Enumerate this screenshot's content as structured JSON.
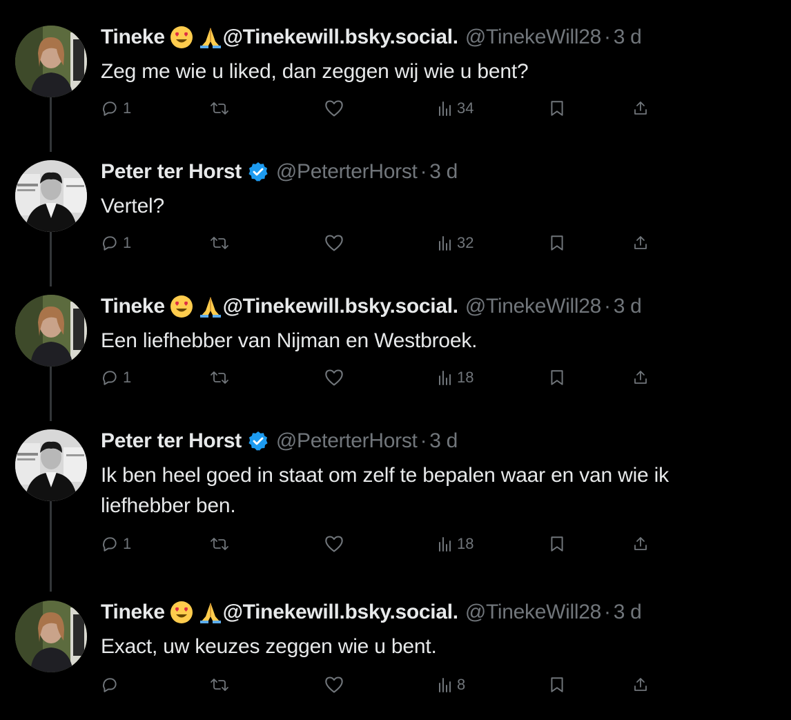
{
  "icons": {
    "reply": "reply-icon",
    "retweet": "retweet-icon",
    "like": "heart-icon",
    "views": "views-icon",
    "bookmark": "bookmark-icon",
    "share": "share-icon",
    "verified": "verified-badge-icon"
  },
  "colors": {
    "background": "#000000",
    "text": "#e7e9ea",
    "secondary": "#71767b",
    "verified": "#1d9bf0"
  },
  "tweets": [
    {
      "name": "Tineke",
      "suffix": "@Tinekewill.bsky.social.",
      "emojis": [
        "heart-eyes-emoji",
        "folded-hands-emoji"
      ],
      "verified": false,
      "handle": "@TinekeWill28",
      "dot": "·",
      "time": "3 d",
      "text": "Zeg me wie u liked, dan zeggen wij wie u bent?",
      "replies": "1",
      "retweets": "",
      "likes": "",
      "views": "34"
    },
    {
      "name": "Peter ter Horst",
      "suffix": "",
      "emojis": [],
      "verified": true,
      "handle": "@PeterterHorst",
      "dot": "·",
      "time": "3 d",
      "text": "Vertel?",
      "replies": "1",
      "retweets": "",
      "likes": "",
      "views": "32"
    },
    {
      "name": "Tineke",
      "suffix": "@Tinekewill.bsky.social.",
      "emojis": [
        "heart-eyes-emoji",
        "folded-hands-emoji"
      ],
      "verified": false,
      "handle": "@TinekeWill28",
      "dot": "·",
      "time": "3 d",
      "text": "Een liefhebber van Nijman en Westbroek.",
      "replies": "1",
      "retweets": "",
      "likes": "",
      "views": "18"
    },
    {
      "name": "Peter ter Horst",
      "suffix": "",
      "emojis": [],
      "verified": true,
      "handle": "@PeterterHorst",
      "dot": "·",
      "time": "3 d",
      "text": "Ik ben heel goed in staat om zelf te bepalen waar en van wie ik liefhebber ben.",
      "replies": "1",
      "retweets": "",
      "likes": "",
      "views": "18"
    },
    {
      "name": "Tineke",
      "suffix": "@Tinekewill.bsky.social.",
      "emojis": [
        "heart-eyes-emoji",
        "folded-hands-emoji"
      ],
      "verified": false,
      "handle": "@TinekeWill28",
      "dot": "·",
      "time": "3 d",
      "text": "Exact, uw keuzes zeggen wie u bent.",
      "replies": "",
      "retweets": "",
      "likes": "",
      "views": "8"
    }
  ]
}
